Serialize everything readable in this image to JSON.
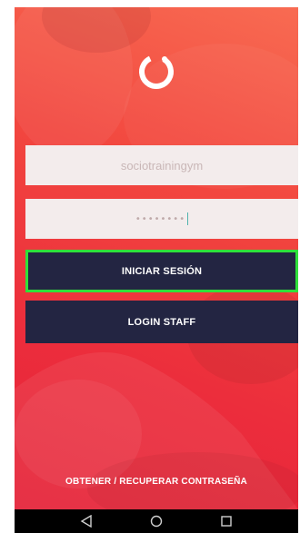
{
  "login": {
    "username_value": "sociotrainingym",
    "password_mask": "••••••••",
    "login_button": "INICIAR SESIÓN",
    "staff_button": "LOGIN STAFF",
    "recover_link": "OBTENER / RECUPERAR CONTRASEÑA"
  },
  "colors": {
    "background_top": "#f86b52",
    "background_bottom": "#e52238",
    "field_bg": "#f3ecec",
    "button_bg": "#232542",
    "focus_outline": "#2fe03a"
  },
  "icons": {
    "logo": "ring-logo-icon",
    "nav_back": "back-triangle-icon",
    "nav_home": "home-circle-icon",
    "nav_recents": "recents-square-icon"
  }
}
